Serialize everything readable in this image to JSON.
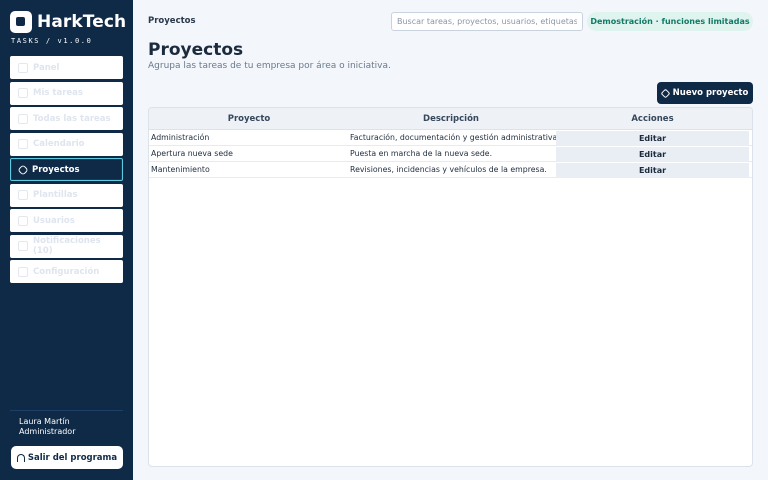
{
  "brand": {
    "name": "HarkTech",
    "sub": "TASKS / v1.0.0"
  },
  "sidebar": {
    "items": [
      {
        "label": "Panel",
        "icon": "dashboard-icon"
      },
      {
        "label": "Mis tareas",
        "icon": "checklist-icon"
      },
      {
        "label": "Todas las tareas",
        "icon": "list-icon"
      },
      {
        "label": "Calendario",
        "icon": "calendar-icon"
      },
      {
        "label": "Proyectos",
        "icon": "tag-icon",
        "active": true
      },
      {
        "label": "Plantillas",
        "icon": "template-icon"
      },
      {
        "label": "Usuarios",
        "icon": "users-icon"
      },
      {
        "label": "Notificaciones (10)",
        "icon": "bell-icon"
      },
      {
        "label": "Configuración",
        "icon": "gear-icon"
      }
    ],
    "user": {
      "name": "Laura Martín",
      "role": "Administrador"
    },
    "exit_label": "Salir del programa"
  },
  "topbar": {
    "title": "Proyectos",
    "search_placeholder": "Buscar tareas, proyectos, usuarios, etiquetas...",
    "demo_badge": "Demostración · funciones limitadas"
  },
  "main": {
    "title": "Proyectos",
    "subtitle": "Agrupa las tareas de tu empresa por área o iniciativa.",
    "new_button": "Nuevo proyecto"
  },
  "table": {
    "columns": [
      "Proyecto",
      "Descripción",
      "Acciones"
    ],
    "rows": [
      {
        "project": "Administración",
        "description": "Facturación, documentación y gestión administrativa.",
        "action": "Editar"
      },
      {
        "project": "Apertura nueva sede",
        "description": "Puesta en marcha de la nueva sede.",
        "action": "Editar"
      },
      {
        "project": "Mantenimiento",
        "description": "Revisiones, incidencias y vehículos de la empresa.",
        "action": "Editar"
      }
    ]
  },
  "colors": {
    "sidebar_bg": "#0f2a47",
    "accent": "#5fc9e0",
    "demo_badge_bg": "#dff4ee",
    "demo_badge_text": "#127a66"
  }
}
